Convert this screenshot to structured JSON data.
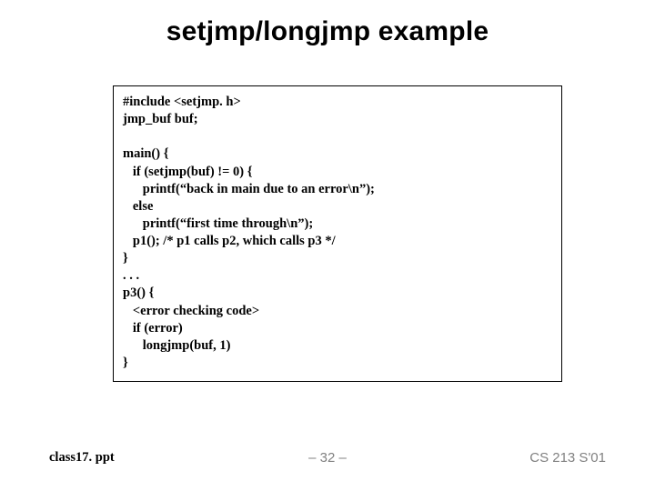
{
  "title": "setjmp/longjmp example",
  "code": "#include <setjmp. h>\njmp_buf buf;\n\nmain() {\n   if (setjmp(buf) != 0) {\n      printf(“back in main due to an error\\n”);\n   else\n      printf(“first time through\\n”);\n   p1(); /* p1 calls p2, which calls p3 */\n}\n. . .\np3() {\n   <error checking code>\n   if (error)\n      longjmp(buf, 1)\n}",
  "footer": {
    "left": "class17. ppt",
    "center": "– 32 –",
    "right": "CS 213 S'01"
  }
}
